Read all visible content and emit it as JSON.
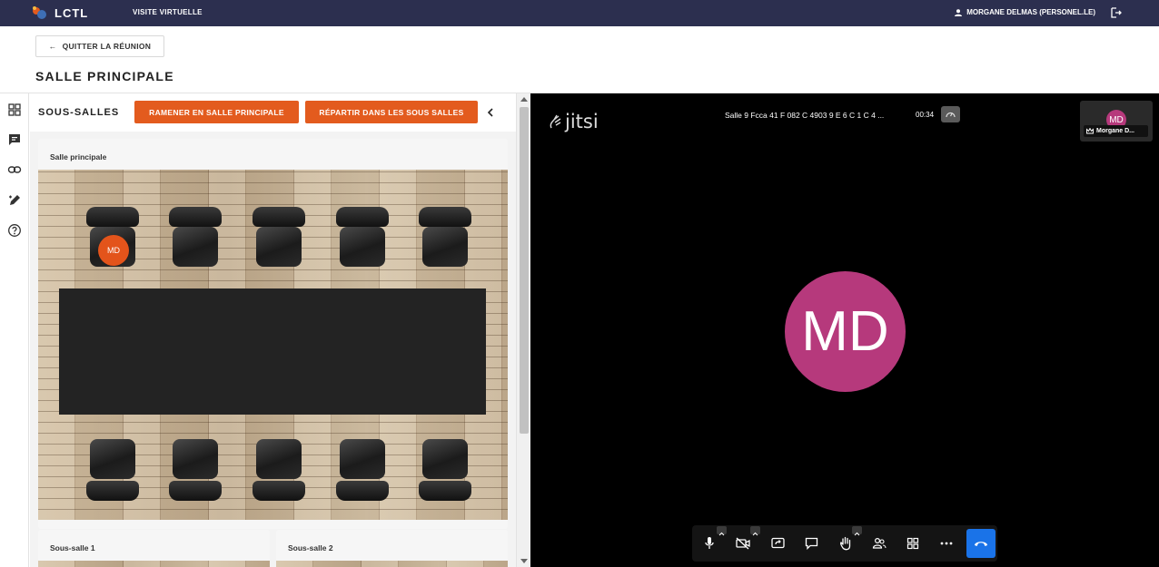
{
  "topbar": {
    "app_name": "LCTL",
    "nav_link": "VISITE VIRTUELLE",
    "user_name": "MORGANE DELMAS (PERSONEL.LE)",
    "bg_color": "#2c2f4f"
  },
  "subheader": {
    "quit_button": "QUITTER LA RÉUNION",
    "page_title": "SALLE PRINCIPALE"
  },
  "leftrail": {
    "icons": [
      "grid-icon",
      "chat-icon",
      "link-icon",
      "edit-icon",
      "help-icon"
    ]
  },
  "panel": {
    "title": "SOUS-SALLES",
    "btn_bring_back": "RAMENER EN SALLE PRINCIPALE",
    "btn_distribute": "RÉPARTIR DANS LES SOUS SALLES",
    "accent_color": "#e35b1e",
    "main_room": {
      "label": "Salle principale",
      "seated_initials": "MD"
    },
    "subrooms": [
      {
        "label": "Sous-salle 1"
      },
      {
        "label": "Sous-salle 2"
      }
    ]
  },
  "video": {
    "logo_text": "jitsi",
    "meeting_name": "Salle 9 Fcca 41 F 082 C 4903 9 E 6 C 1 C 4 ...",
    "timer": "00:34",
    "participant_initials": "MD",
    "thumbnail_name": "Morgane D...",
    "avatar_color": "#b6397c",
    "hangup_color": "#1a73e8"
  }
}
